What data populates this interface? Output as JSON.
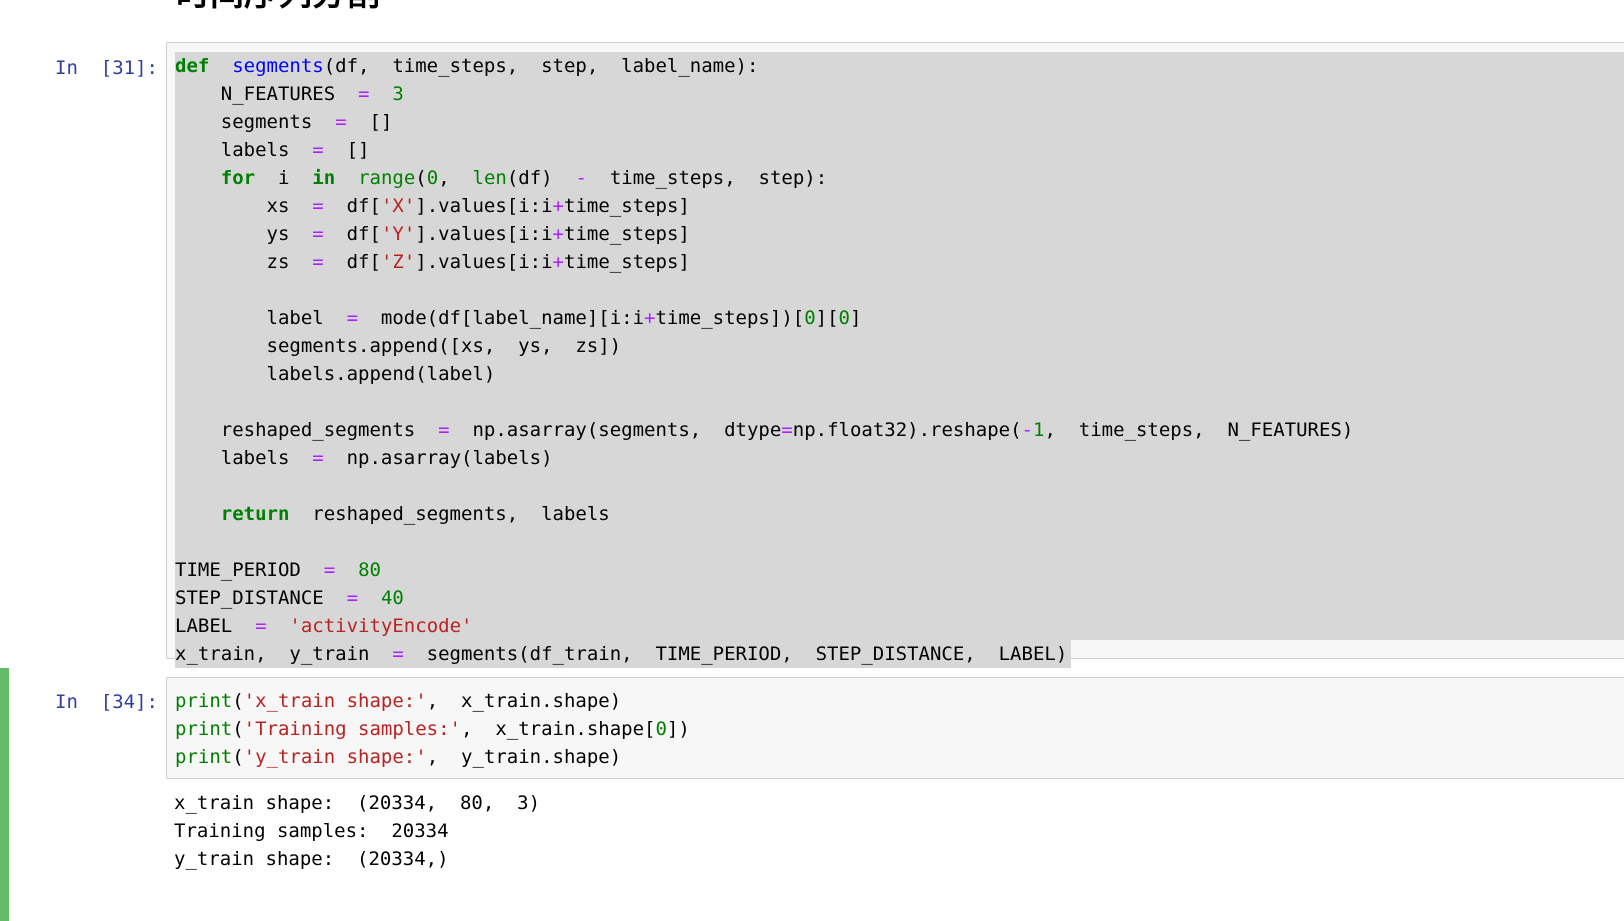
{
  "notebook": {
    "heading": "时间序列分割",
    "cells": [
      {
        "prompt": "In  [31]:",
        "code_lines": [
          [
            [
              "kw",
              "def"
            ],
            [
              "",
              "  "
            ],
            [
              "fn",
              "segments"
            ],
            [
              "",
              "(df,  time_steps,  step,  label_name):"
            ]
          ],
          [
            [
              "",
              "    N_FEATURES  "
            ],
            [
              "op",
              "="
            ],
            [
              "",
              "  "
            ],
            [
              "num",
              "3"
            ]
          ],
          [
            [
              "",
              "    segments  "
            ],
            [
              "op",
              "="
            ],
            [
              "",
              "  []"
            ]
          ],
          [
            [
              "",
              "    labels  "
            ],
            [
              "op",
              "="
            ],
            [
              "",
              "  []"
            ]
          ],
          [
            [
              "",
              "    "
            ],
            [
              "kw",
              "for"
            ],
            [
              "",
              "  i  "
            ],
            [
              "kw",
              "in"
            ],
            [
              "",
              "  "
            ],
            [
              "bi",
              "range"
            ],
            [
              "",
              "("
            ],
            [
              "num",
              "0"
            ],
            [
              "",
              ",  "
            ],
            [
              "bi",
              "len"
            ],
            [
              "",
              "(df)  "
            ],
            [
              "op",
              "-"
            ],
            [
              "",
              "  time_steps,  step):"
            ]
          ],
          [
            [
              "",
              "        xs  "
            ],
            [
              "op",
              "="
            ],
            [
              "",
              "  df["
            ],
            [
              "str",
              "'X'"
            ],
            [
              "",
              "].values[i:i"
            ],
            [
              "op",
              "+"
            ],
            [
              "",
              "time_steps]"
            ]
          ],
          [
            [
              "",
              "        ys  "
            ],
            [
              "op",
              "="
            ],
            [
              "",
              "  df["
            ],
            [
              "str",
              "'Y'"
            ],
            [
              "",
              "].values[i:i"
            ],
            [
              "op",
              "+"
            ],
            [
              "",
              "time_steps]"
            ]
          ],
          [
            [
              "",
              "        zs  "
            ],
            [
              "op",
              "="
            ],
            [
              "",
              "  df["
            ],
            [
              "str",
              "'Z'"
            ],
            [
              "",
              "].values[i:i"
            ],
            [
              "op",
              "+"
            ],
            [
              "",
              "time_steps]"
            ]
          ],
          [
            [
              "",
              ""
            ]
          ],
          [
            [
              "",
              "        label  "
            ],
            [
              "op",
              "="
            ],
            [
              "",
              "  mode(df[label_name][i:i"
            ],
            [
              "op",
              "+"
            ],
            [
              "",
              "time_steps])["
            ],
            [
              "num",
              "0"
            ],
            [
              "",
              "]["
            ],
            [
              "num",
              "0"
            ],
            [
              "",
              "]"
            ]
          ],
          [
            [
              "",
              "        segments.append([xs,  ys,  zs])"
            ]
          ],
          [
            [
              "",
              "        labels.append(label)"
            ]
          ],
          [
            [
              "",
              ""
            ]
          ],
          [
            [
              "",
              "    reshaped_segments  "
            ],
            [
              "op",
              "="
            ],
            [
              "",
              "  np.asarray(segments,  dtype"
            ],
            [
              "op",
              "="
            ],
            [
              "",
              "np.float32).reshape("
            ],
            [
              "op",
              "-"
            ],
            [
              "num",
              "1"
            ],
            [
              "",
              ",  time_steps,  N_FEATURES)"
            ]
          ],
          [
            [
              "",
              "    labels  "
            ],
            [
              "op",
              "="
            ],
            [
              "",
              "  np.asarray(labels)"
            ]
          ],
          [
            [
              "",
              ""
            ]
          ],
          [
            [
              "",
              "    "
            ],
            [
              "kw",
              "return"
            ],
            [
              "",
              "  reshaped_segments,  labels"
            ]
          ],
          [
            [
              "",
              ""
            ]
          ],
          [
            [
              "",
              "TIME_PERIOD  "
            ],
            [
              "op",
              "="
            ],
            [
              "",
              "  "
            ],
            [
              "num",
              "80"
            ]
          ],
          [
            [
              "",
              "STEP_DISTANCE  "
            ],
            [
              "op",
              "="
            ],
            [
              "",
              "  "
            ],
            [
              "num",
              "40"
            ]
          ],
          [
            [
              "",
              "LABEL  "
            ],
            [
              "op",
              "="
            ],
            [
              "",
              "  "
            ],
            [
              "str",
              "'activityEncode'"
            ]
          ],
          [
            [
              "",
              "x_train,  y_train  "
            ],
            [
              "op",
              "="
            ],
            [
              "",
              "  segments(df_train,  TIME_PERIOD,  STEP_DISTANCE,  LABEL)"
            ]
          ]
        ],
        "output_lines": []
      },
      {
        "prompt": "In  [34]:",
        "code_lines": [
          [
            [
              "bi",
              "print"
            ],
            [
              "",
              "("
            ],
            [
              "str",
              "'x_train shape:'"
            ],
            [
              "",
              ",  x_train.shape)"
            ]
          ],
          [
            [
              "bi",
              "print"
            ],
            [
              "",
              "("
            ],
            [
              "str",
              "'Training samples:'"
            ],
            [
              "",
              ",  x_train.shape["
            ],
            [
              "num",
              "0"
            ],
            [
              "",
              "])"
            ]
          ],
          [
            [
              "bi",
              "print"
            ],
            [
              "",
              "("
            ],
            [
              "str",
              "'y_train shape:'"
            ],
            [
              "",
              ",  y_train.shape)"
            ]
          ]
        ],
        "output_lines": [
          "x_train shape:  (20334,  80,  3)",
          "Training samples:  20334",
          "y_train shape:  (20334,)"
        ]
      }
    ]
  }
}
